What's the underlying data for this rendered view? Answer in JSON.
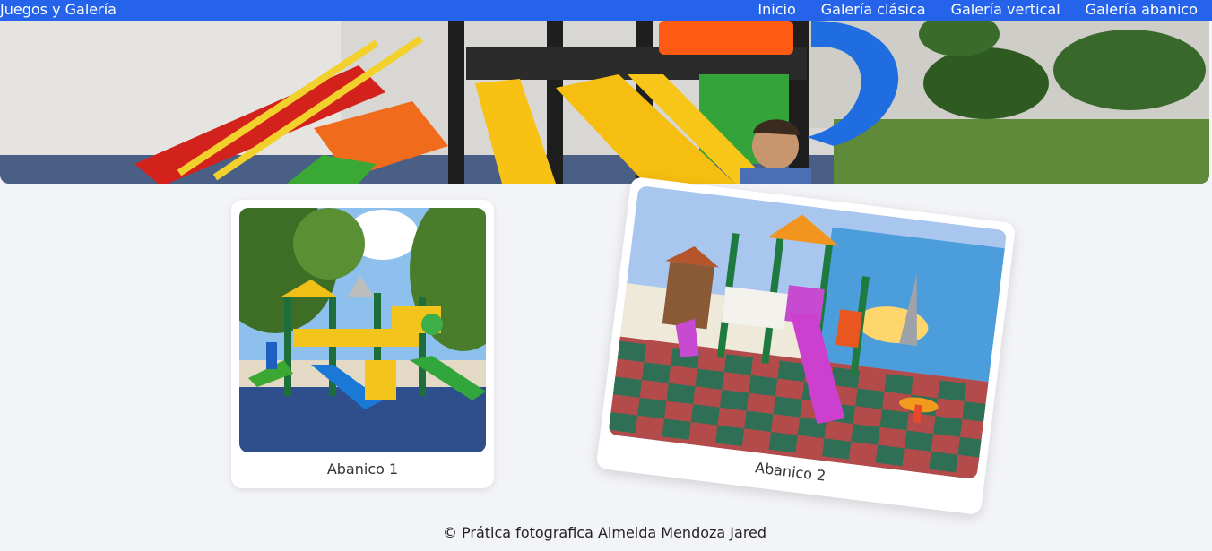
{
  "navbar": {
    "brand": "Juegos y Galería",
    "links": [
      "Inicio",
      "Galería clásica",
      "Galería vertical",
      "Galería abanico"
    ]
  },
  "gallery": [
    {
      "caption": "Abanico 1"
    },
    {
      "caption": "Abanico 2"
    }
  ],
  "footer": {
    "text": "© Prática fotografica Almeida Mendoza Jared"
  },
  "colors": {
    "navbar": "#2563eb",
    "background": "#f3f4f8",
    "card": "#ffffff"
  }
}
